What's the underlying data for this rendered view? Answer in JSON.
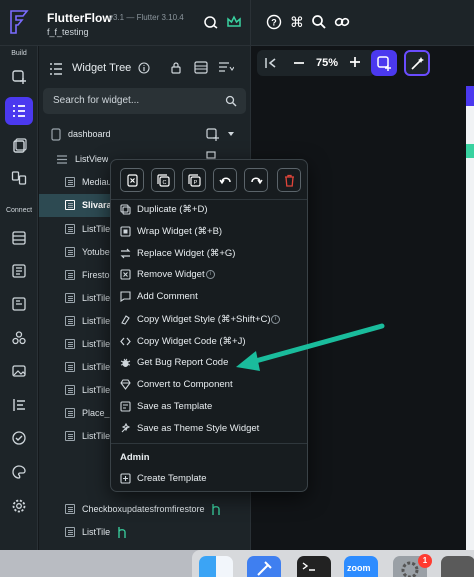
{
  "header": {
    "app_name": "FlutterFlow",
    "version": "v3.1 — Flutter 3.10.4",
    "project": "f_f_testing"
  },
  "rail": {
    "build_label": "Build",
    "connect_label": "Connect"
  },
  "tree": {
    "title": "Widget Tree",
    "search_placeholder": "Search for widget...",
    "rows": [
      {
        "label": "dashboard"
      },
      {
        "label": "ListView"
      },
      {
        "label": "Mediau"
      },
      {
        "label": "Slivarap"
      },
      {
        "label": "ListTile"
      },
      {
        "label": "Yotube"
      },
      {
        "label": "Firesto"
      },
      {
        "label": "ListTile"
      },
      {
        "label": "ListTile"
      },
      {
        "label": "ListTile"
      },
      {
        "label": "ListTile"
      },
      {
        "label": "ListTile"
      },
      {
        "label": "Place_p"
      },
      {
        "label": "ListTile"
      },
      {
        "label": "Checkboxupdatesfromfirestore"
      },
      {
        "label": "ListTile"
      }
    ]
  },
  "canvas": {
    "zoom": "75%"
  },
  "context_menu": {
    "items": [
      {
        "label": "Duplicate (⌘+D)",
        "icon": "duplicate-icon"
      },
      {
        "label": "Wrap Widget (⌘+B)",
        "icon": "wrap-icon"
      },
      {
        "label": "Replace Widget (⌘+G)",
        "icon": "replace-icon"
      },
      {
        "label": "Remove Widget",
        "icon": "remove-icon"
      },
      {
        "label": "Add Comment",
        "icon": "comment-icon"
      },
      {
        "label": "Copy Widget Style (⌘+Shift+C)",
        "icon": "paint-icon"
      },
      {
        "label": "Copy Widget Code (⌘+J)",
        "icon": "code-icon"
      },
      {
        "label": "Get Bug Report Code",
        "icon": "bug-icon"
      },
      {
        "label": "Convert to Component",
        "icon": "component-icon"
      },
      {
        "label": "Save as Template",
        "icon": "template-icon"
      },
      {
        "label": "Save as Theme Style Widget",
        "icon": "theme-icon"
      }
    ],
    "admin_label": "Admin",
    "admin_item": "Create Template"
  },
  "dock": {
    "zoom_label": "zoom",
    "notification_count": "1"
  },
  "colors": {
    "accent": "#4B39EF",
    "teal_arrow": "#1ABC9C",
    "danger": "#E0453A"
  }
}
